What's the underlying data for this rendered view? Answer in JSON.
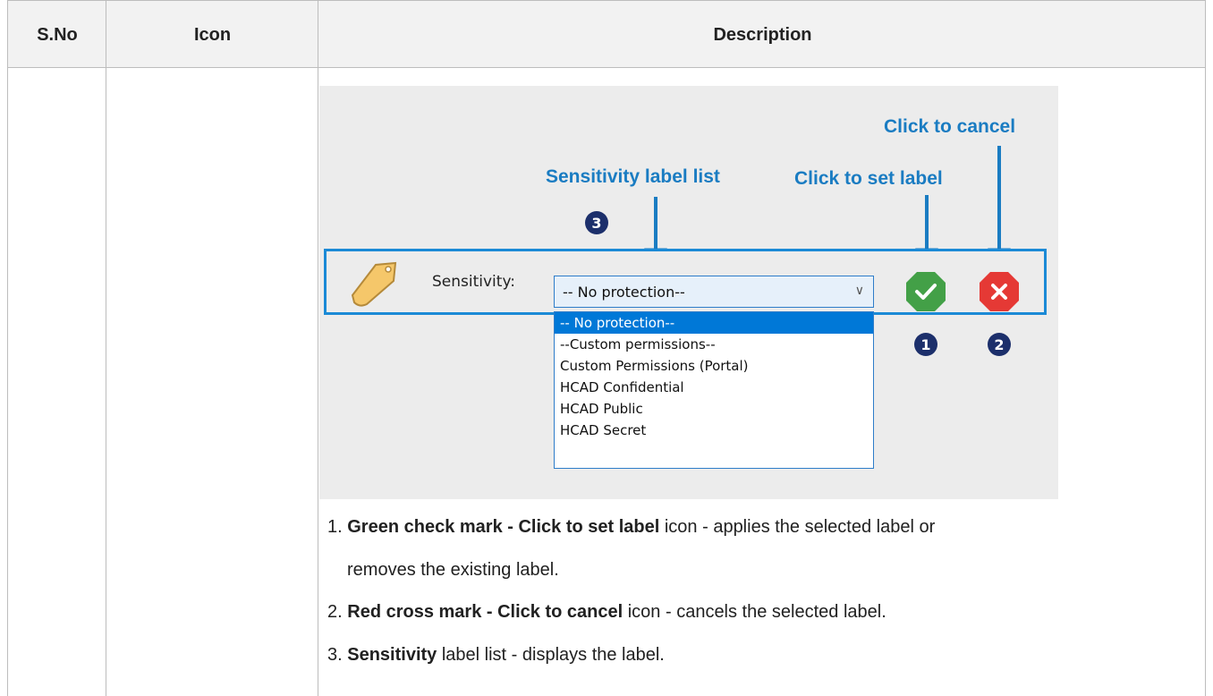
{
  "table": {
    "headers": [
      "S.No",
      "Icon",
      "Description"
    ]
  },
  "screenshot": {
    "callouts": {
      "cancel": "Click to cancel",
      "list": "Sensitivity label list",
      "set": "Click to set label"
    },
    "sensitivity_label": "Sensitivity:",
    "combo_value": "-- No protection--",
    "dropdown_options": [
      "-- No protection--",
      "--Custom permissions--",
      "Custom Permissions (Portal)",
      "HCAD Confidential",
      "HCAD Public",
      "HCAD Secret"
    ],
    "selected_option_index": 0,
    "numbers": [
      "1",
      "2",
      "3"
    ],
    "colors": {
      "callout": "#1a7cc2",
      "frame": "#1b8ad6",
      "check": "#43a047",
      "cancel": "#e53935",
      "tag": "#f5c76a"
    }
  },
  "description": [
    {
      "num": "1.",
      "bold": "Green check mark - Click to set label",
      "rest": " icon - applies the selected label or",
      "cont": "removes the existing label."
    },
    {
      "num": "2.",
      "bold": "Red cross mark - Click to cancel",
      "rest": " icon - cancels the selected label."
    },
    {
      "num": "3.",
      "bold": "Sensitivity",
      "rest": " label list - displays the label."
    }
  ]
}
